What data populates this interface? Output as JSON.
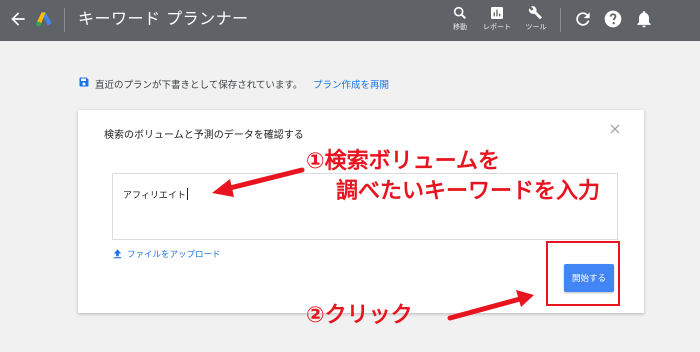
{
  "header": {
    "title": "キーワード プランナー",
    "tools": [
      {
        "label": "移動",
        "icon": "search-icon"
      },
      {
        "label": "レポート",
        "icon": "report-icon"
      },
      {
        "label": "ツール",
        "icon": "wrench-icon"
      }
    ],
    "icons": [
      "back-arrow-icon",
      "google-ads-logo",
      "refresh-icon",
      "help-icon",
      "notification-bell-icon"
    ]
  },
  "draft_notice": {
    "text": "直近のプランが下書きとして保存されています。",
    "link": "プラン作成を再開"
  },
  "dialog": {
    "title": "検索のボリュームと予測のデータを確認する",
    "input_value": "アフィリエイト",
    "upload_label": "ファイルをアップロード",
    "start_button": "開始する"
  },
  "annotations": {
    "note1_line1": "①検索ボリュームを",
    "note1_line2": "調べたいキーワードを入力",
    "note2": "②クリック"
  },
  "colors": {
    "header_bg": "#5f6368",
    "page_bg": "#f1f1f1",
    "link": "#1a73e8",
    "primary_button": "#4285f4",
    "annotation_red": "#e8141f"
  }
}
